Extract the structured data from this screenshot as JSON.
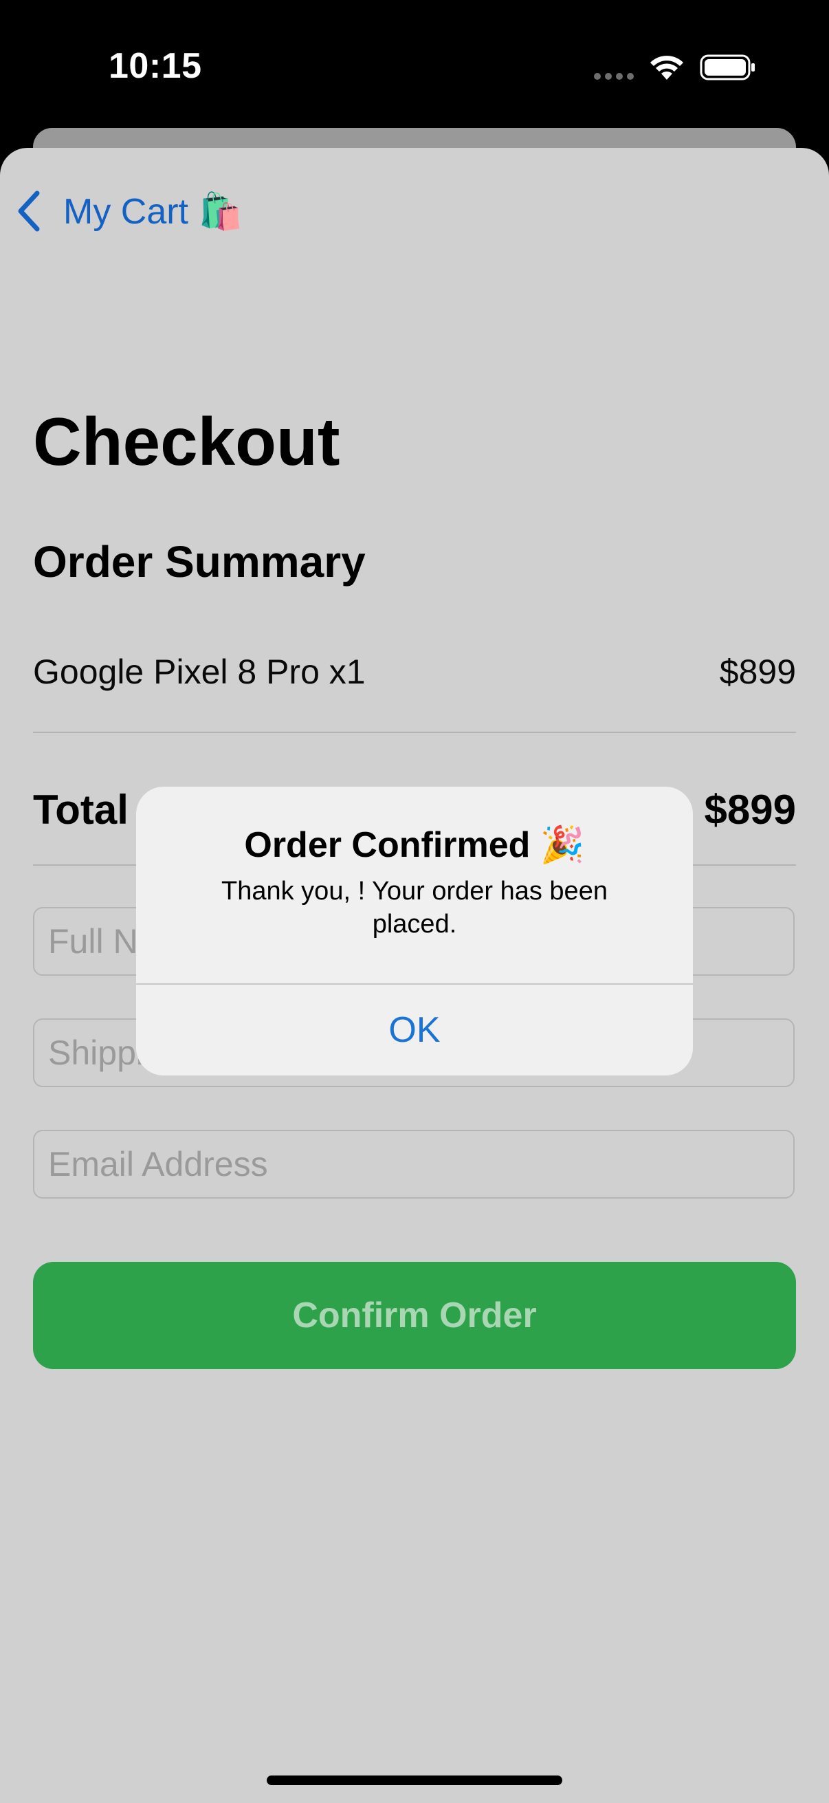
{
  "status_bar": {
    "time": "10:15",
    "icons": [
      "cellular-dots-icon",
      "wifi-icon",
      "battery-icon"
    ]
  },
  "nav": {
    "back_label": "My Cart 🛍️",
    "back_icon": "chevron-left-icon",
    "accent_color": "#1461c4"
  },
  "checkout": {
    "title": "Checkout",
    "summary_title": "Order Summary",
    "items": [
      {
        "name": "Google Pixel 8 Pro x1",
        "price": "$899"
      }
    ],
    "total_label": "Total",
    "total_value": "$899"
  },
  "form": {
    "full_name_placeholder": "Full Name",
    "shipping_placeholder": "Shipping Address",
    "email_placeholder": "Email Address"
  },
  "confirm_button": {
    "label": "Confirm Order",
    "color": "#2da24b"
  },
  "alert": {
    "title": "Order Confirmed 🎉",
    "message": "Thank you, ! Your order has been placed.",
    "ok_label": "OK"
  }
}
